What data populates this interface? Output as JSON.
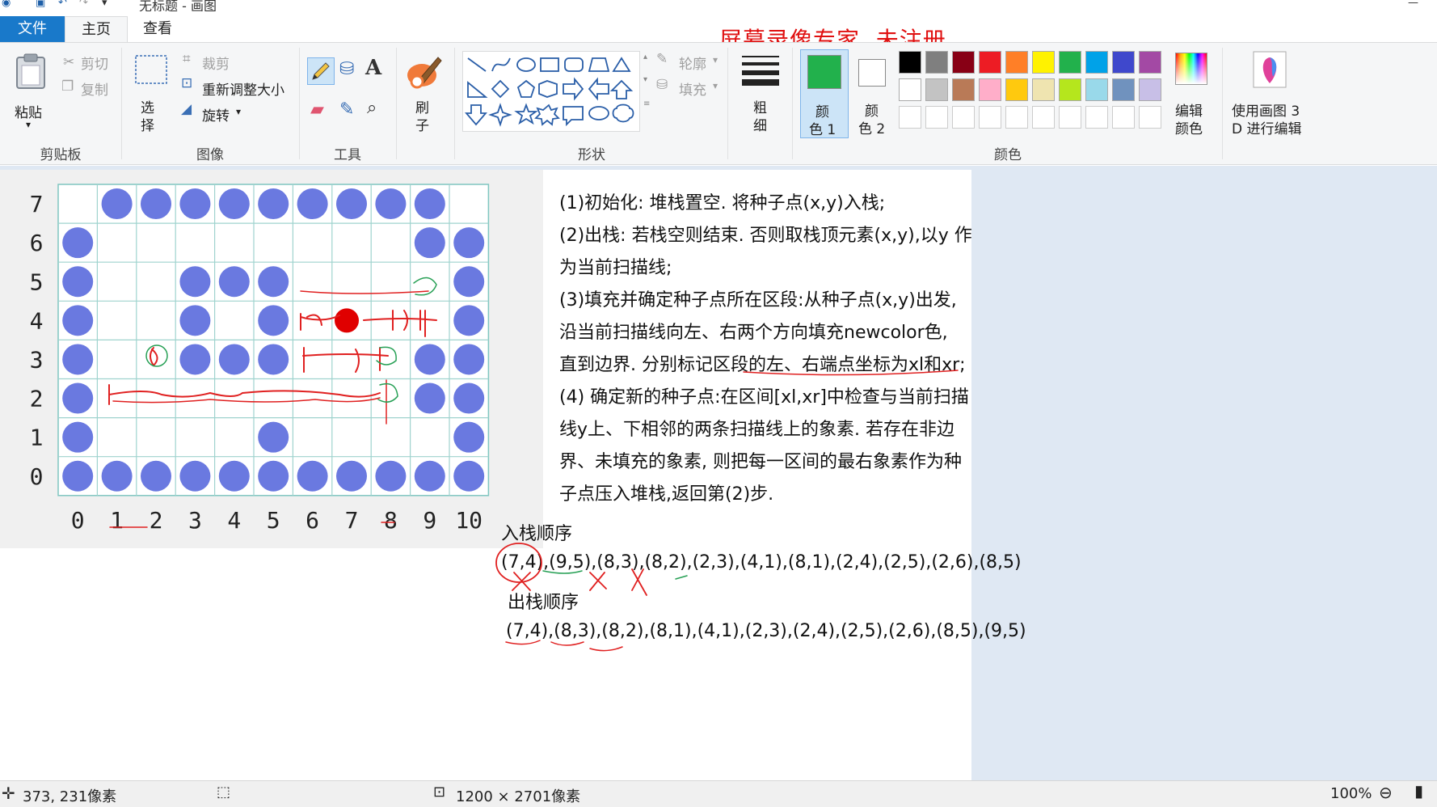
{
  "window": {
    "title": "无标题 - 画图"
  },
  "watermark": "屏幕录像专家  未注册",
  "tabs": [
    "文件",
    "主页",
    "查看"
  ],
  "ribbon": {
    "clipboard": {
      "paste": "粘贴",
      "cut": "剪切",
      "copy": "复制",
      "label": "剪贴板"
    },
    "image": {
      "select": "选择",
      "crop": "裁剪",
      "resize": "重新调整大小",
      "rotate": "旋转",
      "label": "图像"
    },
    "tools": {
      "label": "工具",
      "text_glyph": "A"
    },
    "brushes": {
      "label": "刷子"
    },
    "shapes": {
      "outline": "轮廓",
      "fill": "填充",
      "label": "形状"
    },
    "size": {
      "label": "粗细"
    },
    "color1": {
      "label_line1": "颜",
      "label_line2": "色 1",
      "value": "#22b14c"
    },
    "color2": {
      "label_line1": "颜",
      "label_line2": "色 2",
      "value": "#ffffff"
    },
    "edit_colors": {
      "line1": "编辑",
      "line2": "颜色"
    },
    "paint3d": {
      "line1": "使用画图 3",
      "line2": "D 进行编辑"
    },
    "colors_label": "颜色",
    "palette_row1": [
      "#000000",
      "#7f7f7f",
      "#880015",
      "#ed1c24",
      "#ff7f27",
      "#fff200",
      "#22b14c",
      "#00a2e8",
      "#3f48cc",
      "#a349a4"
    ],
    "palette_row2": [
      "#ffffff",
      "#c3c3c3",
      "#b97a57",
      "#ffaec9",
      "#ffc90e",
      "#efe4b0",
      "#b5e61d",
      "#99d9ea",
      "#7092be",
      "#c8bfe7"
    ]
  },
  "grid": {
    "y_labels": [
      "7",
      "6",
      "5",
      "4",
      "3",
      "2",
      "1",
      "0"
    ],
    "x_labels": [
      "0",
      "1",
      "2",
      "3",
      "4",
      "5",
      "6",
      "7",
      "8",
      "9",
      "10"
    ],
    "dots": {
      "7": [
        1,
        2,
        3,
        4,
        5,
        6,
        7,
        8,
        9
      ],
      "6": [
        0,
        9,
        10
      ],
      "5": [
        0,
        3,
        4,
        5,
        10
      ],
      "4": [
        0,
        3,
        5,
        10
      ],
      "3": [
        0,
        3,
        4,
        5,
        9,
        10
      ],
      "2": [
        0,
        9,
        10
      ],
      "1": [
        0,
        5,
        10
      ],
      "0": [
        0,
        1,
        2,
        3,
        4,
        5,
        6,
        7,
        8,
        9,
        10
      ]
    },
    "dot_color": "#6a79e0",
    "seed_color": "#e00000"
  },
  "description": [
    "(1)初始化: 堆栈置空. 将种子点(x,y)入栈;",
    "(2)出栈: 若栈空则结束. 否则取栈顶元素(x,y),以y 作",
    "为当前扫描线;",
    "(3)填充并确定种子点所在区段:从种子点(x,y)出发,",
    "沿当前扫描线向左、右两个方向填充newcolor色,",
    "直到边界. 分别标记区段的左、右端点坐标为xl和xr;",
    "(4) 确定新的种子点:在区间[xl,xr]中检查与当前扫描",
    "线y上、下相邻的两条扫描线上的象素. 若存在非边",
    "界、未填充的象素, 则把每一区间的最右象素作为种",
    "子点压入堆栈,返回第(2)步."
  ],
  "push_label": "入栈顺序",
  "push_seq": "(7,4),(9,5),(8,3),(8,2),(2,3),(4,1),(8,1),(2,4),(2,5),(2,6),(8,5)",
  "pop_label": "出栈顺序",
  "pop_seq": "(7,4),(8,3),(8,2),(8,1),(4,1),(2,3),(2,4),(2,5),(2,6),(8,5),(9,5)",
  "status": {
    "cursor": "373, 231像素",
    "size": "1200 × 2701像素",
    "zoom": "100%"
  }
}
